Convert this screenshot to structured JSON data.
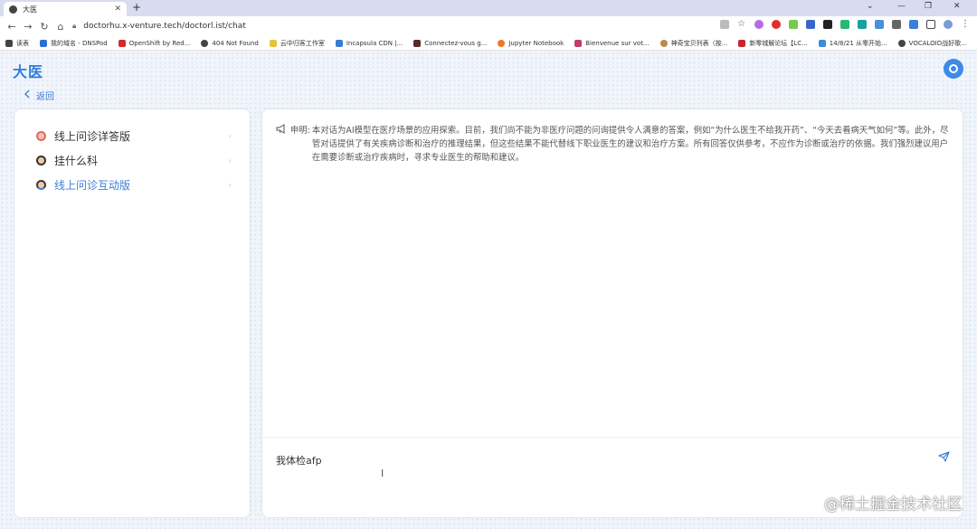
{
  "browser": {
    "tab_title": "大医",
    "url": "doctorhu.x-venture.tech/doctorl.ist/chat",
    "bookmarks": [
      "读表",
      "我的域名 - DNSPod",
      "OpenShift by Red...",
      "404 Not Found",
      "云中归客工作室",
      "Incapsula CDN |...",
      "Connectez-vous g...",
      "Jupyter Notebook",
      "Bienvenue sur vot...",
      "神奇宝贝列表（按...",
      "新零城解论坛【LC...",
      "14/8/21 从零开始...",
      "VOCALOID战好歌..."
    ]
  },
  "header": {
    "logo": "大医",
    "back_label": "返回"
  },
  "sidebar": {
    "items": [
      {
        "label": "线上问诊详答版",
        "active": false
      },
      {
        "label": "挂什么科",
        "active": false
      },
      {
        "label": "线上问诊互动版",
        "active": true
      }
    ]
  },
  "chat": {
    "notice_label": "申明:",
    "notice_text": "本对话为AI模型在医疗场景的应用探索。目前，我们尚不能为非医疗问题的问询提供令人满意的答案，例如“为什么医生不给我开药”、“今天去看病天气如何”等。此外，尽管对话提供了有关疾病诊断和治疗的推理结果，但这些结果不能代替线下职业医生的建议和治疗方案。所有回答仅供参考，不应作为诊断或治疗的依据。我们强烈建议用户在需要诊断或治疗疾病时，寻求专业医生的帮助和建议。",
    "input_value": "我体检afp"
  },
  "watermark": "@稀土掘金技术社区",
  "colors": {
    "accent": "#3c7fd8",
    "logo": "#2f7ddc"
  }
}
